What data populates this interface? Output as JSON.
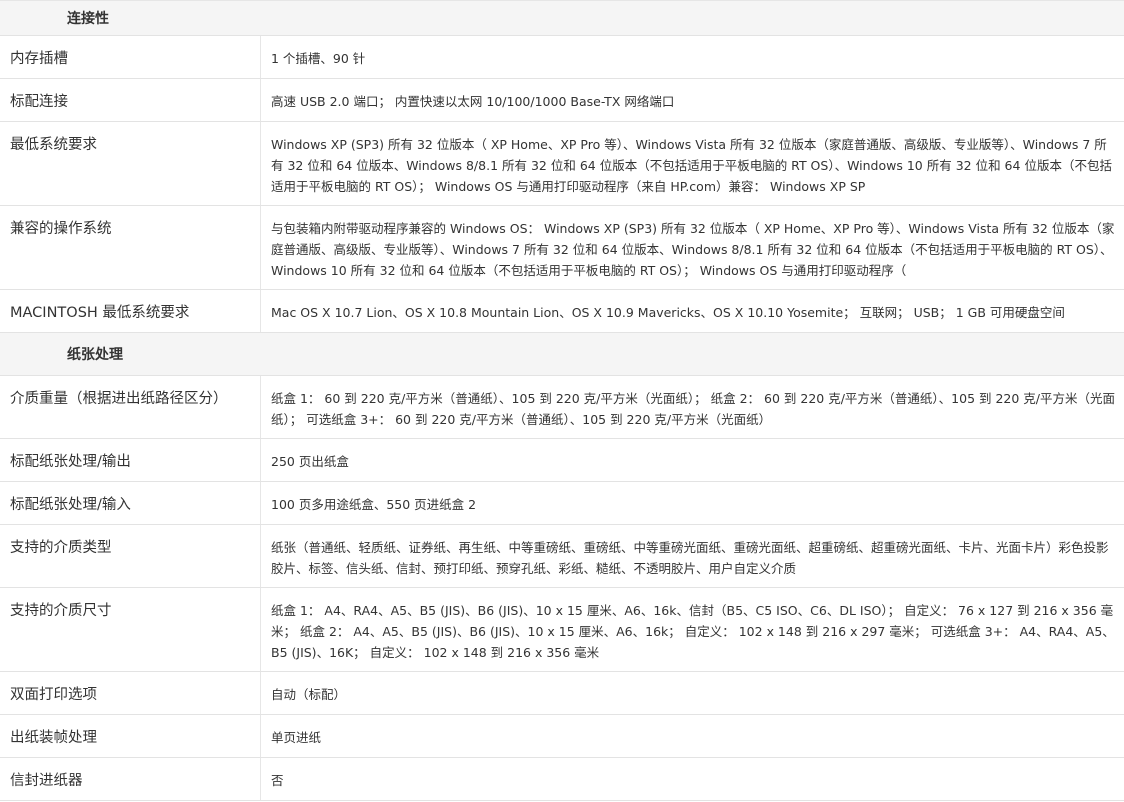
{
  "sections": [
    {
      "title": "连接性",
      "rows": [
        {
          "label": "内存插槽",
          "value": "1 个插槽、90 针"
        },
        {
          "label": "标配连接",
          "value": "高速 USB 2.0 端口； 内置快速以太网 10/100/1000 Base-TX 网络端口"
        },
        {
          "label": "最低系统要求",
          "value": "Windows XP (SP3) 所有 32 位版本（ XP Home、XP Pro 等）、Windows Vista 所有 32 位版本（家庭普通版、高级版、专业版等）、Windows 7 所有 32 位和 64 位版本、Windows 8/8.1 所有 32 位和 64 位版本（不包括适用于平板电脑的 RT OS）、Windows 10 所有 32 位和 64 位版本（不包括适用于平板电脑的 RT OS）； Windows OS 与通用打印驱动程序（来自 HP.com）兼容： Windows XP SP"
        },
        {
          "label": "兼容的操作系统",
          "value": "与包装箱内附带驱动程序兼容的 Windows OS： Windows XP (SP3) 所有 32 位版本（ XP Home、XP Pro 等）、Windows Vista 所有 32 位版本（家庭普通版、高级版、专业版等）、Windows 7 所有 32 位和 64 位版本、Windows 8/8.1 所有 32 位和 64 位版本（不包括适用于平板电脑的 RT OS）、Windows 10 所有 32 位和 64 位版本（不包括适用于平板电脑的 RT OS）； Windows OS 与通用打印驱动程序（"
        },
        {
          "label": "MACINTOSH 最低系统要求",
          "value": "Mac OS X 10.7 Lion、OS X 10.8 Mountain Lion、OS X 10.9 Mavericks、OS X 10.10 Yosemite； 互联网； USB； 1 GB 可用硬盘空间"
        }
      ]
    },
    {
      "title": "纸张处理",
      "rows": [
        {
          "label": "介质重量（根据进出纸路径区分）",
          "value": "纸盒 1： 60 到 220 克/平方米（普通纸）、105 到 220 克/平方米（光面纸）； 纸盒 2： 60 到 220 克/平方米（普通纸）、105 到 220 克/平方米（光面纸）； 可选纸盒 3+： 60 到 220 克/平方米（普通纸）、105 到 220 克/平方米（光面纸）"
        },
        {
          "label": "标配纸张处理/输出",
          "value": "250 页出纸盒"
        },
        {
          "label": "标配纸张处理/输入",
          "value": "100 页多用途纸盒、550 页进纸盒 2"
        },
        {
          "label": "支持的介质类型",
          "value": "纸张（普通纸、轻质纸、证券纸、再生纸、中等重磅纸、重磅纸、中等重磅光面纸、重磅光面纸、超重磅纸、超重磅光面纸、卡片、光面卡片）彩色投影胶片、标签、信头纸、信封、预打印纸、预穿孔纸、彩纸、糙纸、不透明胶片、用户自定义介质"
        },
        {
          "label": "支持的介质尺寸",
          "value": "纸盒 1： A4、RA4、A5、B5 (JIS)、B6 (JIS)、10 x 15 厘米、A6、16k、信封（B5、C5 ISO、C6、DL ISO）； 自定义： 76 x 127 到 216 x 356 毫米； 纸盒 2： A4、A5、B5 (JIS)、B6 (JIS)、10 x 15 厘米、A6、16k； 自定义： 102 x 148 到 216 x 297 毫米； 可选纸盒 3+： A4、RA4、A5、B5 (JIS)、16K； 自定义： 102 x 148 到 216 x 356 毫米"
        },
        {
          "label": "双面打印选项",
          "value": "自动（标配）"
        },
        {
          "label": "出纸装帧处理",
          "value": "单页进纸"
        },
        {
          "label": "信封进纸器",
          "value": "否"
        }
      ]
    }
  ]
}
